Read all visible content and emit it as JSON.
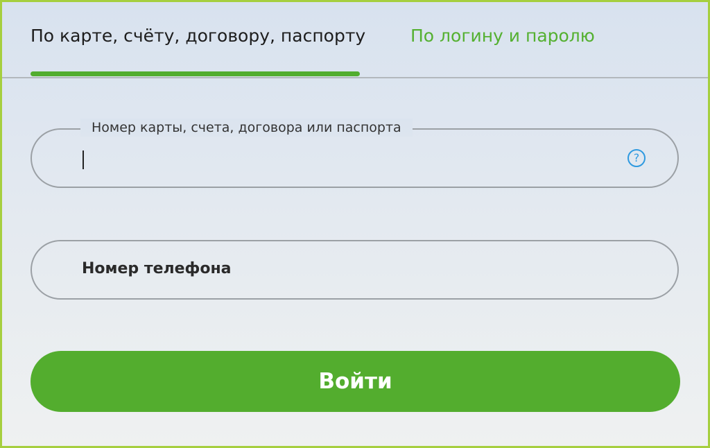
{
  "tabs": {
    "active_label": "По карте, счёту, договору, паспорту",
    "inactive_label": "По логину и паролю"
  },
  "fields": {
    "card_label": "Номер карты, счета, договора или паспорта",
    "card_value": "",
    "help_icon": "question-circle-icon",
    "help_glyph": "?",
    "phone_label": "Номер телефона"
  },
  "submit_label": "Войти",
  "colors": {
    "accent_green": "#53ad2e",
    "help_blue": "#2f9ae0",
    "frame_border": "#a6cf3f"
  }
}
